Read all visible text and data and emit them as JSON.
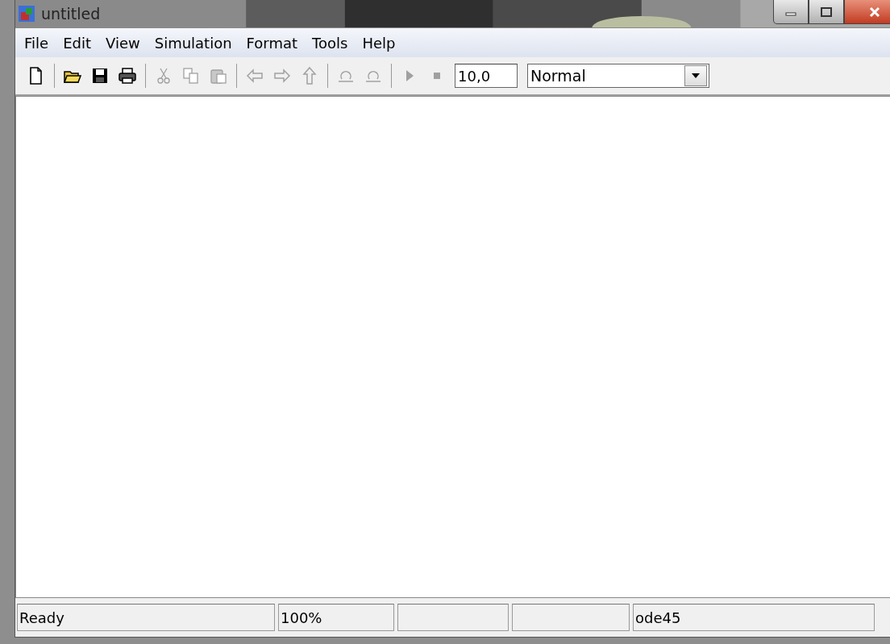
{
  "window": {
    "title": "untitled"
  },
  "menu": [
    {
      "label": "File"
    },
    {
      "label": "Edit"
    },
    {
      "label": "View"
    },
    {
      "label": "Simulation"
    },
    {
      "label": "Format"
    },
    {
      "label": "Tools"
    },
    {
      "label": "Help"
    }
  ],
  "toolbar": {
    "groups": [
      [
        {
          "kind": "new",
          "disabled": false
        }
      ],
      [
        {
          "kind": "open",
          "disabled": false
        },
        {
          "kind": "save",
          "disabled": false
        },
        {
          "kind": "print",
          "disabled": false
        }
      ],
      [
        {
          "kind": "cut",
          "disabled": true
        },
        {
          "kind": "copy",
          "disabled": true
        },
        {
          "kind": "paste",
          "disabled": true
        }
      ],
      [
        {
          "kind": "back",
          "disabled": true
        },
        {
          "kind": "forward",
          "disabled": true
        },
        {
          "kind": "up",
          "disabled": true
        }
      ],
      [
        {
          "kind": "undo",
          "disabled": true
        },
        {
          "kind": "redo",
          "disabled": true
        }
      ],
      [
        {
          "kind": "start",
          "disabled": true
        },
        {
          "kind": "stop",
          "disabled": true
        }
      ]
    ],
    "stop_time": "10,0",
    "mode": "Normal"
  },
  "status_bar": [
    {
      "kind": "text",
      "text": "Ready"
    },
    {
      "kind": "text",
      "text": "100%"
    },
    {
      "kind": "empty"
    },
    {
      "kind": "empty"
    },
    {
      "kind": "text",
      "text": "ode45"
    }
  ]
}
